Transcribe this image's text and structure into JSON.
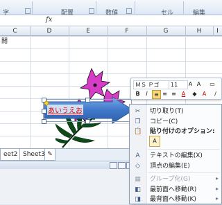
{
  "ribbon": {
    "groups": [
      "字",
      "配置",
      "数値",
      "セル",
      "編集"
    ],
    "partial_left": "字"
  },
  "formula_bar": {
    "fx_label": "fx"
  },
  "columns": [
    "C",
    "D",
    "E",
    "F",
    "G",
    "H",
    "I"
  ],
  "cell_partial": "閲",
  "sheet_tabs": [
    "eet2",
    "Sheet3"
  ],
  "shape": {
    "text": "あいうえお",
    "text_color": "#dd0000"
  },
  "mini_toolbar": {
    "font_name": "ＭＳ Ｐゴ",
    "font_size": "11",
    "row2": [
      "B",
      "I",
      "≡",
      "≡",
      "≡",
      "A",
      "A",
      "/"
    ]
  },
  "context_menu": {
    "items": [
      {
        "label": "切り取り(T)",
        "icon": "scissors-icon",
        "disabled": false
      },
      {
        "label": "コピー(C)",
        "icon": "copy-icon",
        "disabled": false
      },
      {
        "label": "貼り付けのオプション:",
        "icon": "paste-icon",
        "disabled": false,
        "header": true
      },
      {
        "label": "テキストの編集(X)",
        "icon": "text-edit-icon",
        "disabled": false
      },
      {
        "label": "頂点の編集(E)",
        "icon": "edit-points-icon",
        "disabled": false
      },
      {
        "label": "グループ化(G)",
        "icon": "group-icon",
        "disabled": true,
        "submenu": true
      },
      {
        "label": "最前面へ移動(R)",
        "icon": "bring-front-icon",
        "disabled": false,
        "submenu": true
      },
      {
        "label": "最背面へ移動(K)",
        "icon": "send-back-icon",
        "disabled": false,
        "submenu": true
      }
    ]
  },
  "colors": {
    "accent": "#2b6cc4",
    "arrow_blue": "#4a86d6",
    "selection": "#cfe0f5"
  }
}
